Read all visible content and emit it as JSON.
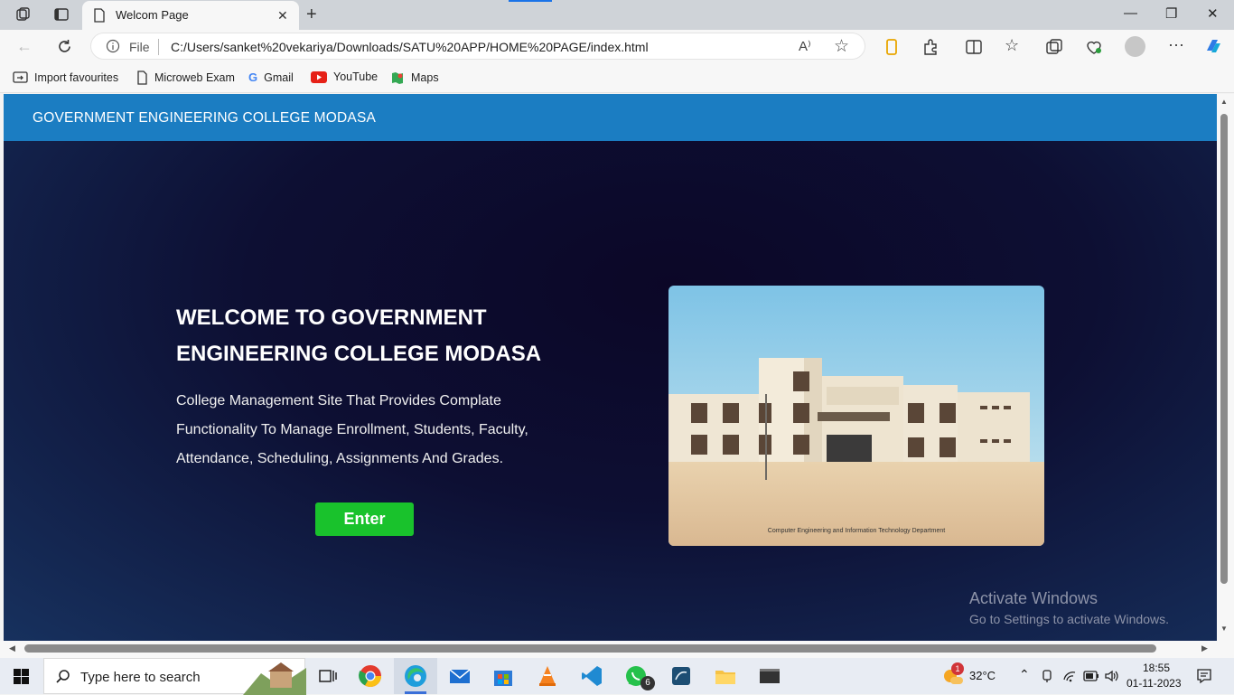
{
  "browser": {
    "tab": {
      "title": "Welcom Page"
    },
    "address": {
      "scheme_label": "File",
      "url": "C:/Users/sanket%20vekariya/Downloads/SATU%20APP/HOME%20PAGE/index.html"
    },
    "favourites": [
      {
        "label": "Import favourites",
        "icon": "import-icon"
      },
      {
        "label": "Microweb Exam",
        "icon": "page-icon"
      },
      {
        "label": "Gmail",
        "icon": "google-icon"
      },
      {
        "label": "YouTube",
        "icon": "youtube-icon"
      },
      {
        "label": "Maps",
        "icon": "maps-icon"
      }
    ]
  },
  "page": {
    "navbar": {
      "brand": "GOVERNMENT ENGINEERING COLLEGE MODASA",
      "color": "#1b7dc2"
    },
    "hero": {
      "title_line1": "WELCOME TO GOVERNMENT",
      "title_line2": "ENGINEERING COLLEGE MODASA",
      "desc_line1": "College Management Site That Provides Complate",
      "desc_line2": "Functionality To Manage Enrollment, Students, Faculty,",
      "desc_line3": "Attendance, Scheduling, Assignments And Grades.",
      "button_label": "Enter",
      "button_color": "#19c22c"
    },
    "photo": {
      "caption": "Computer Engineering and Information Technology Department"
    },
    "watermark": {
      "line1": "Activate Windows",
      "line2": "Go to Settings to activate Windows."
    }
  },
  "taskbar": {
    "search_placeholder": "Type here to search",
    "weather": "32°C",
    "weather_badge": "1",
    "whatsapp_badge": "6",
    "time": "18:55",
    "date": "01-11-2023"
  }
}
